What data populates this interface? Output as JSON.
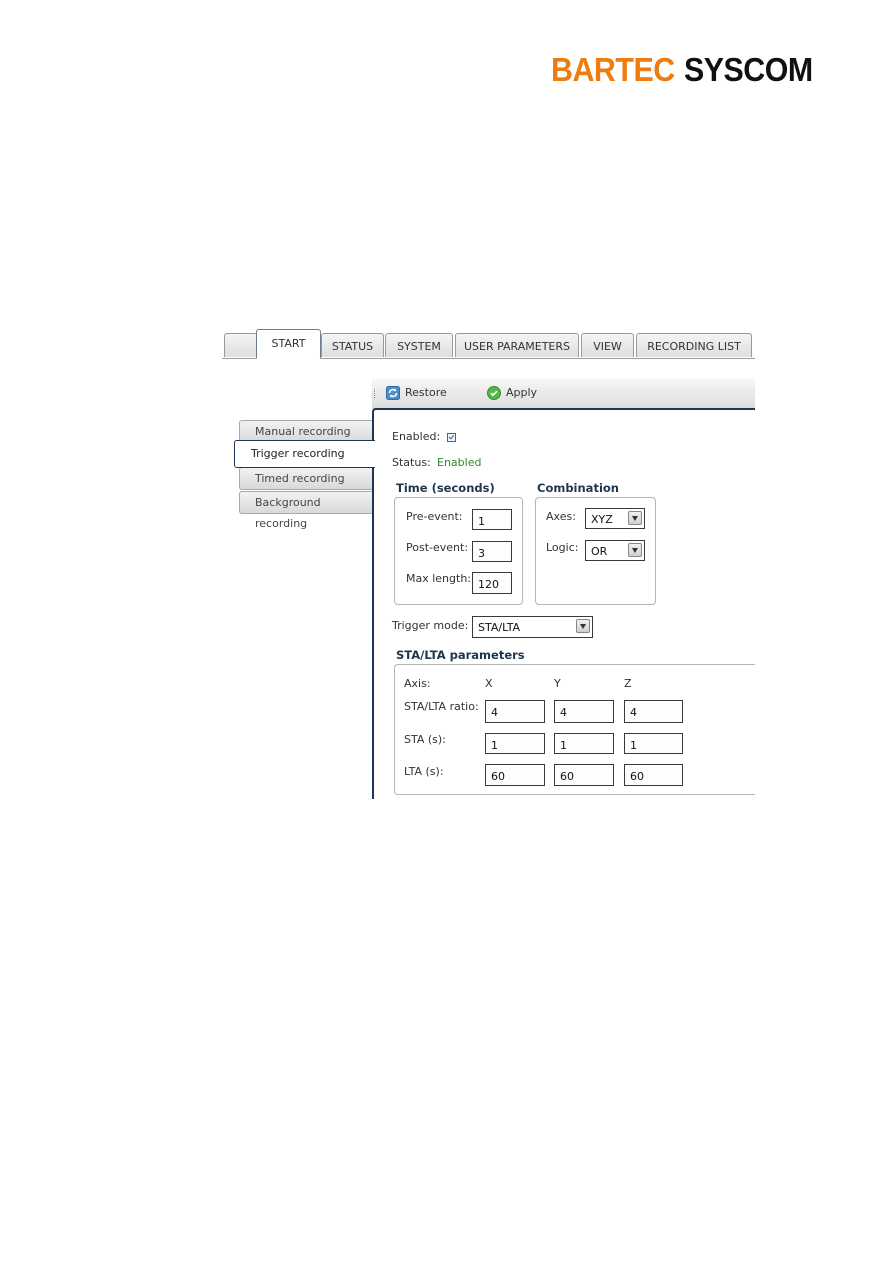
{
  "brand": {
    "part1": "BARTEC",
    "part2": "SYSCOM",
    "color1": "#ee7d11",
    "color2": "#111111"
  },
  "tabs": [
    {
      "label": ""
    },
    {
      "label": "START",
      "active": true
    },
    {
      "label": "STATUS"
    },
    {
      "label": "SYSTEM"
    },
    {
      "label": "USER PARAMETERS"
    },
    {
      "label": "VIEW"
    },
    {
      "label": "RECORDING LIST"
    }
  ],
  "sidebar": {
    "items": [
      {
        "label": "Manual recording"
      },
      {
        "label": "Trigger recording",
        "active": true
      },
      {
        "label": "Timed recording"
      },
      {
        "label": "Background recording"
      }
    ]
  },
  "toolbar": {
    "restore_label": "Restore",
    "apply_label": "Apply"
  },
  "form": {
    "enabled_label": "Enabled:",
    "enabled_checked": true,
    "status_label": "Status:",
    "status_value": "Enabled",
    "time": {
      "title": "Time (seconds)",
      "pre_event_label": "Pre-event:",
      "pre_event_value": "1",
      "post_event_label": "Post-event:",
      "post_event_value": "3",
      "max_length_label": "Max length:",
      "max_length_value": "120"
    },
    "combination": {
      "title": "Combination",
      "axes_label": "Axes:",
      "axes_value": "XYZ",
      "logic_label": "Logic:",
      "logic_value": "OR"
    },
    "trigger_mode_label": "Trigger mode:",
    "trigger_mode_value": "STA/LTA",
    "stalta": {
      "title": "STA/LTA parameters",
      "axis_label": "Axis:",
      "axes": [
        "X",
        "Y",
        "Z"
      ],
      "rows": [
        {
          "label": "STA/LTA ratio:",
          "values": [
            "4",
            "4",
            "4"
          ]
        },
        {
          "label": "STA (s):",
          "values": [
            "1",
            "1",
            "1"
          ]
        },
        {
          "label": "LTA (s):",
          "values": [
            "60",
            "60",
            "60"
          ]
        }
      ]
    }
  }
}
